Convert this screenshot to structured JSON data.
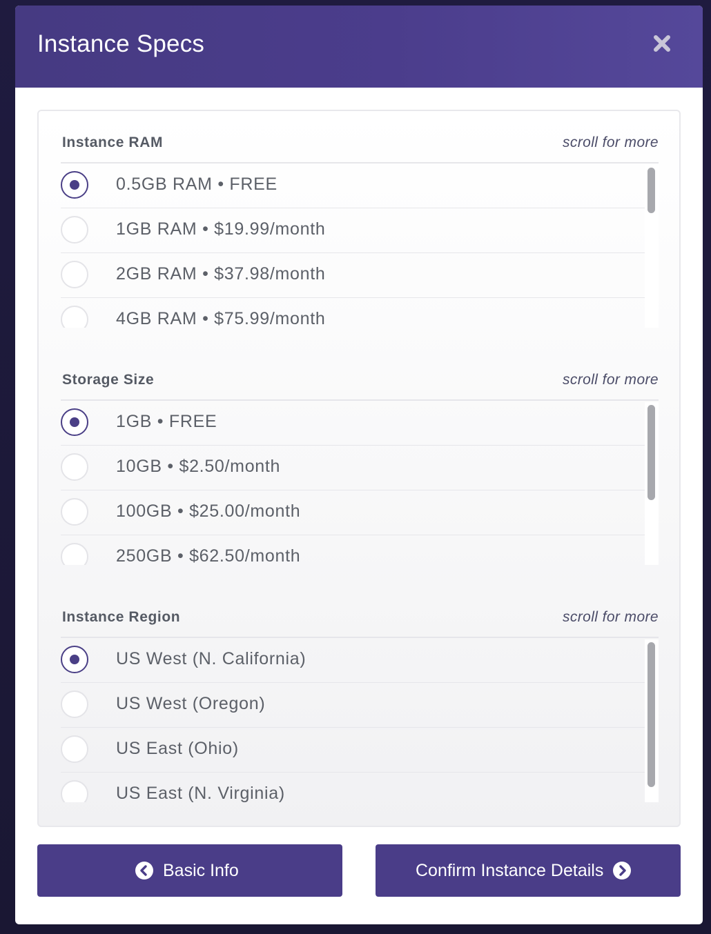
{
  "modal": {
    "title": "Instance Specs"
  },
  "colors": {
    "accent": "#4a3d88",
    "header": "#4b3d8c"
  },
  "sections": [
    {
      "title": "Instance RAM",
      "hint": "scroll for more",
      "options": [
        {
          "label": "0.5GB RAM • FREE",
          "selected": true
        },
        {
          "label": "1GB RAM • $19.99/month",
          "selected": false
        },
        {
          "label": "2GB RAM • $37.98/month",
          "selected": false
        },
        {
          "label": "4GB RAM • $75.99/month",
          "selected": false
        }
      ]
    },
    {
      "title": "Storage Size",
      "hint": "scroll for more",
      "options": [
        {
          "label": "1GB • FREE",
          "selected": true
        },
        {
          "label": "10GB • $2.50/month",
          "selected": false
        },
        {
          "label": "100GB • $25.00/month",
          "selected": false
        },
        {
          "label": "250GB • $62.50/month",
          "selected": false
        }
      ]
    },
    {
      "title": "Instance Region",
      "hint": "scroll for more",
      "options": [
        {
          "label": "US West (N. California)",
          "selected": true
        },
        {
          "label": "US West (Oregon)",
          "selected": false
        },
        {
          "label": "US East (Ohio)",
          "selected": false
        },
        {
          "label": "US East (N. Virginia)",
          "selected": false
        }
      ]
    }
  ],
  "footer": {
    "back_label": "Basic Info",
    "back_icon": "chevron-left-circle-icon",
    "next_label": "Confirm Instance Details",
    "next_icon": "chevron-right-circle-icon"
  }
}
